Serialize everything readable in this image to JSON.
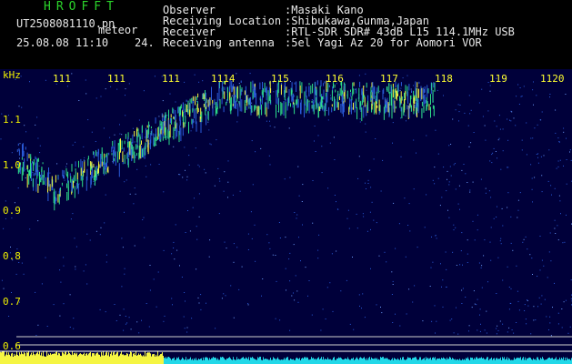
{
  "header": {
    "brand": "HROFFT",
    "filename": "UT2508081110.pn",
    "filename_suffix": "meteor",
    "datetime": "25.08.08 11:10    24.",
    "info": [
      {
        "label": "Observer",
        "value": ":Masaki Kano"
      },
      {
        "label": "Receiving Location",
        "value": ":Shibukawa,Gunma,Japan"
      },
      {
        "label": "Receiver",
        "value": ":RTL-SDR SDR# 43dB L15 114.1MHz USB"
      },
      {
        "label": "Receiving antenna",
        "value": ":5el Yagi Az 20 for Aomori VOR"
      }
    ]
  },
  "plot": {
    "unit_label": "kHz",
    "y_ticks": [
      "1.1",
      "1.0",
      "0.9",
      "0.8",
      "0.7",
      "0.6"
    ],
    "time_labels": [
      "111",
      "111",
      "111",
      "1114",
      "115",
      "116",
      "117",
      "118",
      "119",
      "1120"
    ],
    "colors": {
      "background": "#00003a",
      "signal_high": "#f5f542",
      "signal_mid": "#2ee08a",
      "signal_low": "#2a5bd9",
      "bar_yellow": "#f5f542",
      "bar_cyan": "#22d8e8"
    }
  }
}
